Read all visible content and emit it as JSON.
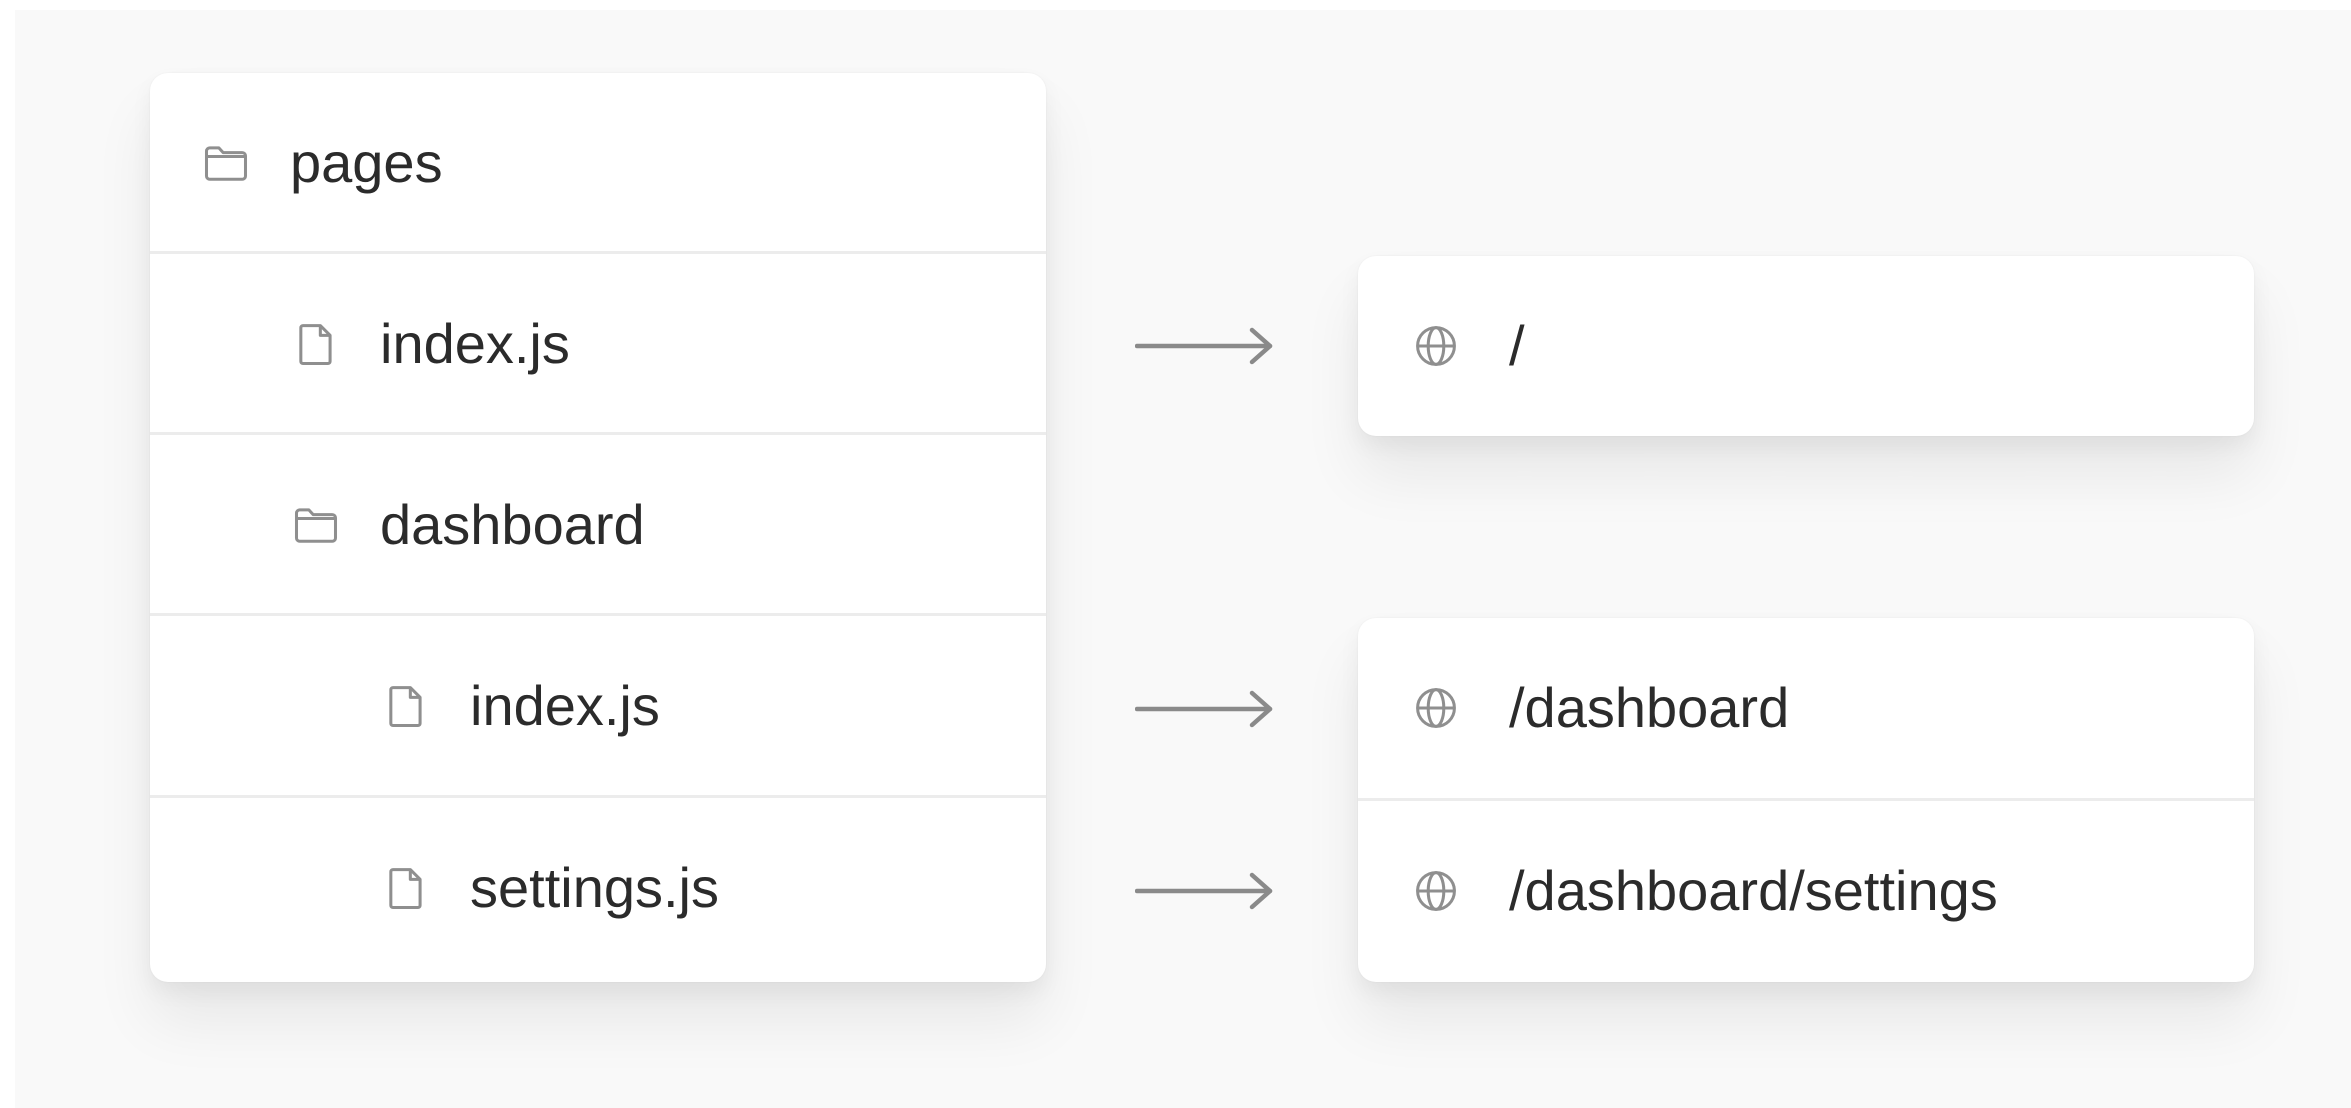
{
  "file_tree": {
    "items": [
      {
        "label": "pages",
        "type": "folder",
        "depth": 0
      },
      {
        "label": "index.js",
        "type": "file",
        "depth": 1
      },
      {
        "label": "dashboard",
        "type": "folder",
        "depth": 1
      },
      {
        "label": "index.js",
        "type": "file",
        "depth": 2
      },
      {
        "label": "settings.js",
        "type": "file",
        "depth": 2
      }
    ]
  },
  "routes": {
    "items": [
      {
        "label": "/",
        "icon": "globe-icon"
      },
      {
        "label": "/dashboard",
        "icon": "globe-icon"
      },
      {
        "label": "/dashboard/settings",
        "icon": "globe-icon"
      }
    ]
  },
  "colors": {
    "background": "#f9f9f9",
    "panel": "#ffffff",
    "text": "#2b2b2b",
    "icon": "#8f8f8f",
    "arrow": "#8a8a8a",
    "divider": "#ececec"
  }
}
